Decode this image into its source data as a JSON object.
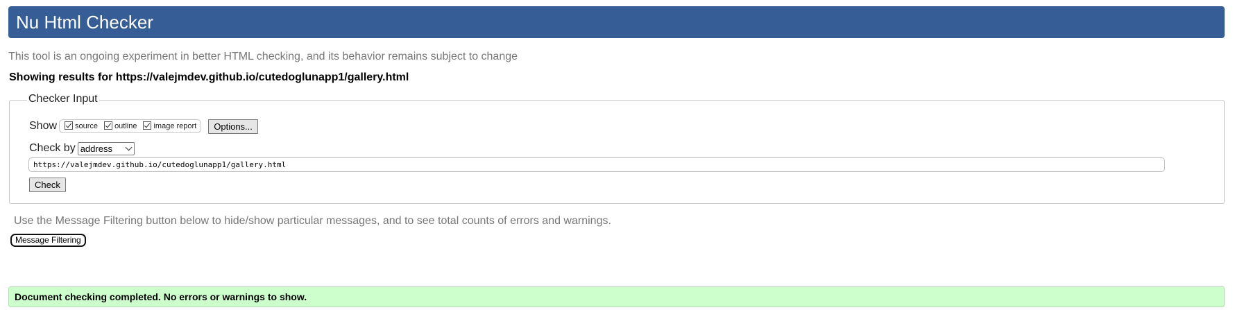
{
  "header": {
    "title": "Nu Html Checker"
  },
  "tagline": "This tool is an ongoing experiment in better HTML checking, and its behavior remains subject to change",
  "showing_results": "Showing results for https://valejmdev.github.io/cutedoglunapp1/gallery.html",
  "checker_input": {
    "legend": "Checker Input",
    "show_label": "Show",
    "show_options": [
      {
        "label": "source",
        "checked": true
      },
      {
        "label": "outline",
        "checked": true
      },
      {
        "label": "image report",
        "checked": true
      }
    ],
    "options_button": "Options...",
    "check_by_label": "Check by",
    "check_by_value": "address",
    "url_value": "https://valejmdev.github.io/cutedoglunapp1/gallery.html",
    "check_button": "Check"
  },
  "filter_note": "Use the Message Filtering button below to hide/show particular messages, and to see total counts of errors and warnings.",
  "filter_button": "Message Filtering",
  "result_message": "Document checking completed. No errors or warnings to show.",
  "colors": {
    "header_bg": "#365d95",
    "success_bg": "#ccffcc",
    "muted_text": "#777777"
  },
  "icons": {
    "checkbox": "checkmark-icon",
    "dropdown": "chevron-down-icon"
  }
}
